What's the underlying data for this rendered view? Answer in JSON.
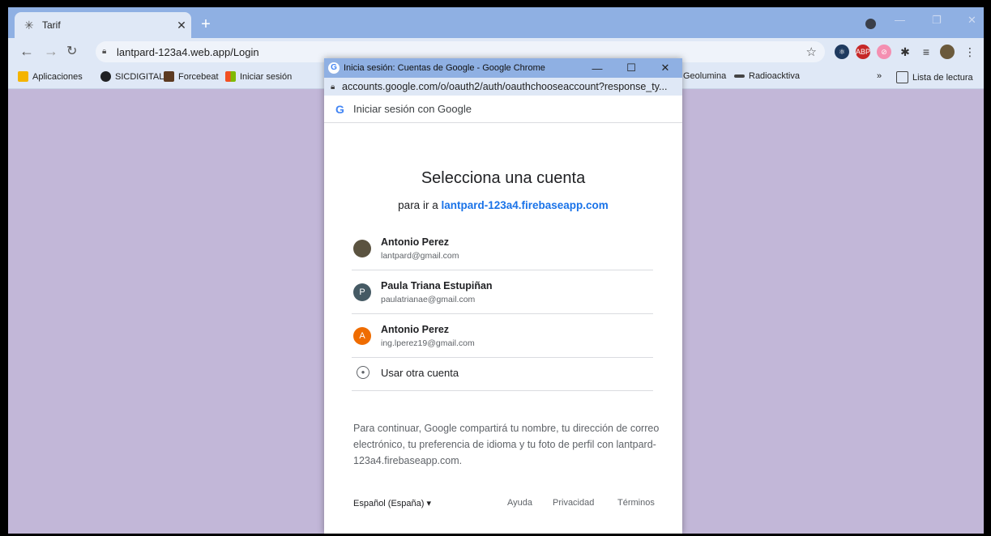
{
  "browser": {
    "tab_title": "Tarif",
    "url": "lantpard-123a4.web.app/Login",
    "bookmarks": [
      "Aplicaciones",
      "SICDIGITAL",
      "Forcebeat",
      "Iniciar sesión",
      "Geolumina",
      "Radioacktiva"
    ],
    "reading_list": "Lista de lectura"
  },
  "popup": {
    "window_title": "Inicia sesión: Cuentas de Google - Google Chrome",
    "address": "accounts.google.com/o/oauth2/auth/oauthchooseaccount?response_ty...",
    "header": "Iniciar sesión con Google",
    "heading": "Selecciona una cuenta",
    "sub_prefix": "para ir a",
    "sub_link": "lantpard-123a4.firebaseapp.com",
    "accounts": [
      {
        "name": "Antonio Perez",
        "email": "lantpard@gmail.com",
        "initial": ""
      },
      {
        "name": "Paula Triana Estupiñan",
        "email": "paulatrianae@gmail.com",
        "initial": "P"
      },
      {
        "name": "Antonio Perez",
        "email": "ing.lperez19@gmail.com",
        "initial": "A"
      }
    ],
    "other_account": "Usar otra cuenta",
    "notice": "Para continuar, Google compartirá tu nombre, tu dirección de correo electrónico, tu preferencia de idioma y tu foto de perfil con lantpard-123a4.firebaseapp.com.",
    "footer": {
      "language": "Español (España)",
      "help": "Ayuda",
      "privacy": "Privacidad",
      "terms": "Términos"
    }
  },
  "colors": {
    "page_bg": "#c2b7d8",
    "link": "#1a73e8"
  }
}
